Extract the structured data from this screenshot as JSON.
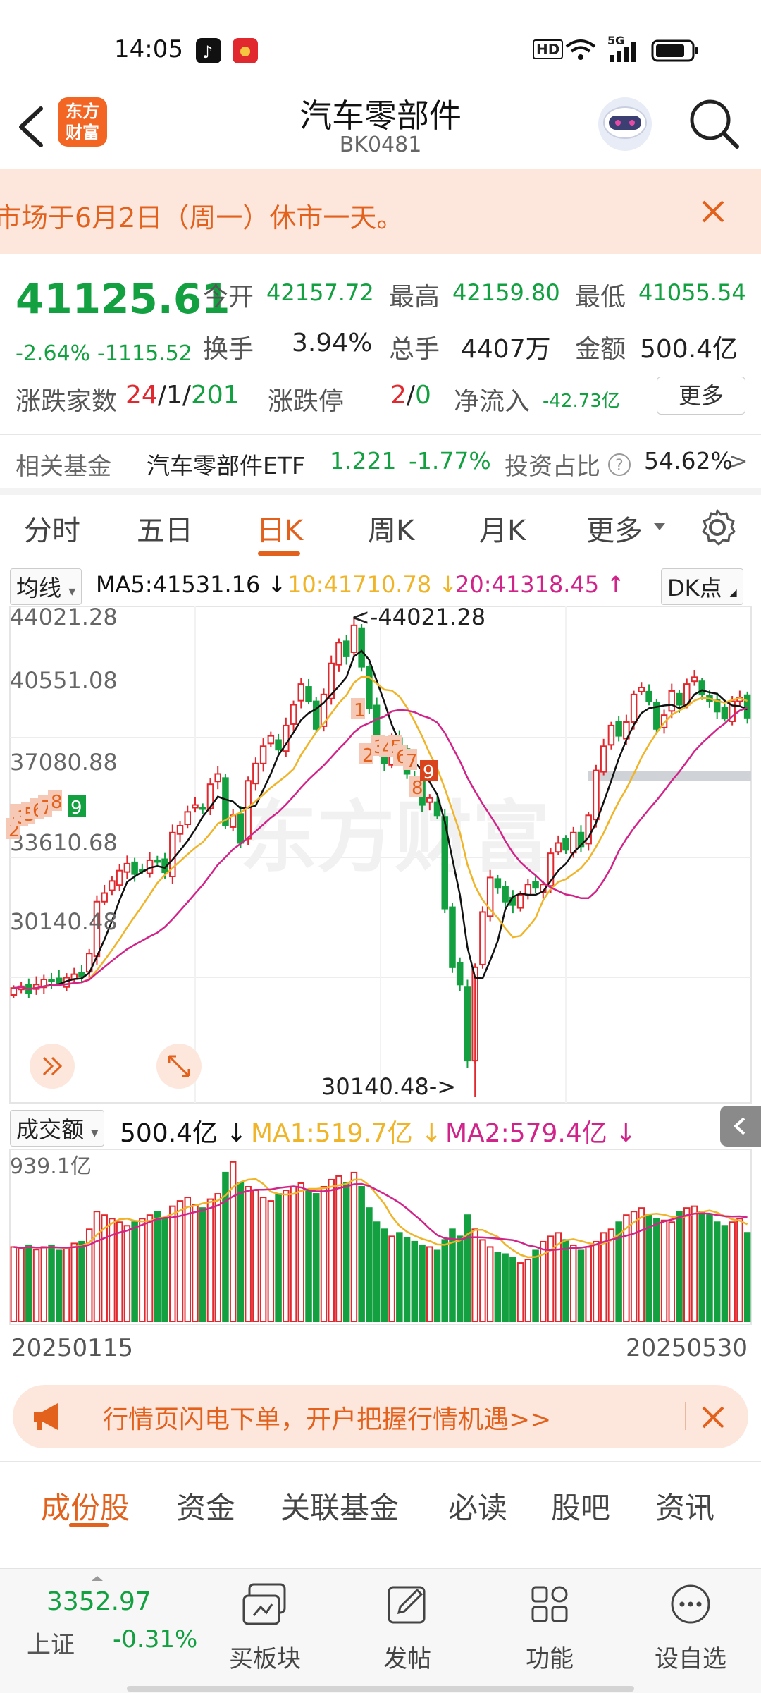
{
  "status_bar": {
    "time": "14:05",
    "hd": "HD",
    "network": "5G"
  },
  "header": {
    "title": "汽车零部件",
    "code": "BK0481",
    "logo_text": "东方财富"
  },
  "notice": {
    "text": "市场于6月2日（周一）休市一天。"
  },
  "quote": {
    "price": "41125.61",
    "change_pct": "-2.64%",
    "change": "-1115.52",
    "open_label": "今开",
    "open": "42157.72",
    "high_label": "最高",
    "high": "42159.80",
    "low_label": "最低",
    "low": "41055.54",
    "turnover_label": "换手",
    "turnover": "3.94%",
    "volume_label": "总手",
    "volume": "4407万",
    "amount_label": "金额",
    "amount": "500.4亿",
    "advdec_label": "涨跌家数",
    "adv": "24",
    "flat": "1",
    "dec": "201",
    "limit_label": "涨跌停",
    "limit_up": "2",
    "limit_down": "0",
    "netflow_label": "净流入",
    "netflow": "-42.73亿",
    "more": "更多"
  },
  "fund": {
    "label": "相关基金",
    "name": "汽车零部件ETF",
    "price": "1.221",
    "pct": "-1.77%",
    "ratio_label": "投资占比",
    "ratio": "54.62%",
    "arrow": ">"
  },
  "tabs": [
    "分时",
    "五日",
    "日K",
    "周K",
    "月K",
    "更多"
  ],
  "active_tab": "日K",
  "ma_bar": {
    "selector": "均线",
    "ma5": "MA5:41531.16",
    "ma10": "10:41710.78",
    "ma20": "20:41318.45",
    "dk": "DK点"
  },
  "volume_bar": {
    "selector": "成交额",
    "value": "500.4亿",
    "ma1": "MA1:519.7亿",
    "ma2": "MA2:579.4亿"
  },
  "colors": {
    "up": "#e0282e",
    "down": "#13a040",
    "ma5": "#111111",
    "ma10": "#f0b429",
    "ma20": "#d1248a",
    "accent": "#e2621d"
  },
  "chart_data": [
    {
      "type": "candlestick",
      "y_ticks": [
        "44021.28",
        "40551.08",
        "37080.88",
        "33610.68",
        "30140.48"
      ],
      "ylim": [
        30140.48,
        44021.28
      ],
      "max_label": "<-44021.28",
      "min_label": "30140.48->",
      "x": [
        "20250115",
        "20250530"
      ],
      "close": [
        33300,
        33350,
        33150,
        33400,
        33550,
        33500,
        33450,
        33600,
        33700,
        33650,
        34300,
        35800,
        36050,
        36400,
        36700,
        36900,
        36600,
        36700,
        37000,
        36950,
        36650,
        37800,
        38000,
        38400,
        38600,
        38500,
        39200,
        39500,
        38000,
        38300,
        37500,
        39300,
        39800,
        40300,
        40600,
        40200,
        40900,
        41500,
        42100,
        41600,
        40800,
        41800,
        42700,
        43300,
        42900,
        43800,
        42600,
        41400,
        40300,
        39800,
        40500,
        40100,
        39500,
        39300,
        38600,
        38800,
        38300,
        35600,
        33900,
        33400,
        31200,
        33900,
        35500,
        36500,
        36200,
        35800,
        35700,
        36000,
        36300,
        36200,
        36300,
        37200,
        37500,
        37300,
        37800,
        37400,
        38300,
        39600,
        40300,
        40900,
        40600,
        41000,
        41800,
        42000,
        41600,
        40800,
        41200,
        41900,
        41500,
        42100,
        42300,
        41800,
        41600,
        41300,
        41100,
        41600,
        41700,
        41125.61
      ]
    },
    {
      "type": "bar",
      "name": "成交额",
      "ylim": [
        0,
        939.1
      ],
      "y_tick": "939.1亿",
      "values": [
        420,
        410,
        430,
        405,
        420,
        430,
        400,
        415,
        440,
        450,
        520,
        620,
        600,
        580,
        560,
        540,
        560,
        580,
        600,
        620,
        580,
        650,
        680,
        700,
        660,
        640,
        690,
        720,
        840,
        900,
        780,
        760,
        740,
        700,
        680,
        720,
        740,
        760,
        780,
        740,
        720,
        760,
        800,
        820,
        780,
        840,
        760,
        640,
        560,
        520,
        480,
        500,
        470,
        450,
        430,
        420,
        400,
        460,
        520,
        480,
        600,
        520,
        460,
        420,
        390,
        380,
        360,
        330,
        350,
        400,
        450,
        480,
        500,
        460,
        430,
        400,
        420,
        450,
        500,
        520,
        560,
        600,
        620,
        640,
        600,
        580,
        570,
        560,
        620,
        640,
        650,
        620,
        600,
        560,
        540,
        560,
        580,
        500.4
      ]
    }
  ],
  "markers": {
    "left": [
      "2",
      "4",
      "3",
      "5",
      "6",
      "7",
      "8",
      "9"
    ],
    "mid": [
      "1",
      "2",
      "3",
      "4",
      "5",
      "6",
      "7",
      "8",
      "9"
    ]
  },
  "promo": {
    "text": "行情页闪电下单，开户把握行情机遇>>"
  },
  "subtabs": [
    "成份股",
    "资金",
    "关联基金",
    "必读",
    "股吧",
    "资讯"
  ],
  "active_subtab": "成份股",
  "bottom_nav": {
    "index_price": "3352.97",
    "index_name": "上证",
    "index_pct": "-0.31%",
    "items": [
      "买板块",
      "发帖",
      "功能",
      "设自选"
    ]
  },
  "watermark": "东方财富"
}
